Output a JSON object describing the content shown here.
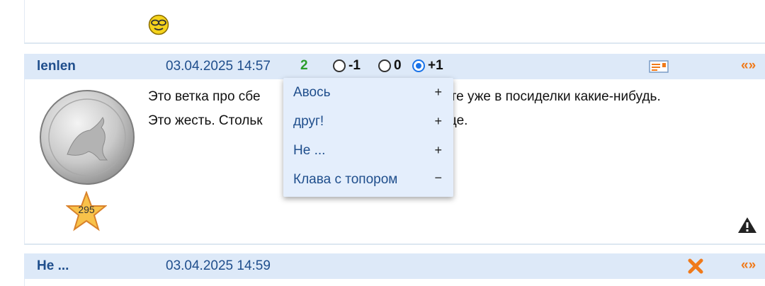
{
  "prev_post": {
    "smiley_icon": "cool-smiley-icon"
  },
  "post1": {
    "author": "lenlen",
    "date": "03.04.2025 14:57",
    "score": "2",
    "votes": [
      {
        "label": "-1",
        "checked": false
      },
      {
        "label": "0",
        "checked": false
      },
      {
        "label": "+1",
        "checked": true
      }
    ],
    "text_line1_a": "Это ветка про сбе",
    "text_line1_b": "уйте уже в посиделки какие-нибудь.",
    "text_line2_a": "Это жесть. Стольк",
    "text_line2_b": "еще.",
    "rating_number": "295",
    "nav_arrows": "«»",
    "icons": {
      "message": "message-icon",
      "warning": "warning-icon",
      "avatar": "silver-kangaroo-coin-avatar"
    }
  },
  "voters_dropdown": {
    "items": [
      {
        "name": "Авось",
        "sign": "+"
      },
      {
        "name": "друг!",
        "sign": "+"
      },
      {
        "name": "Не ...",
        "sign": "+"
      },
      {
        "name": "Клава с топором",
        "sign": "−"
      }
    ]
  },
  "post2": {
    "author": "Не ...",
    "date": "03.04.2025 14:59",
    "nav_arrows": "«»",
    "icons": {
      "delete": "close-x-icon"
    }
  },
  "colors": {
    "header_bg": "#dde9f8",
    "link_blue": "#1f4e8c",
    "score_green": "#2a9d2a",
    "arrow_orange": "#f07a1a"
  }
}
